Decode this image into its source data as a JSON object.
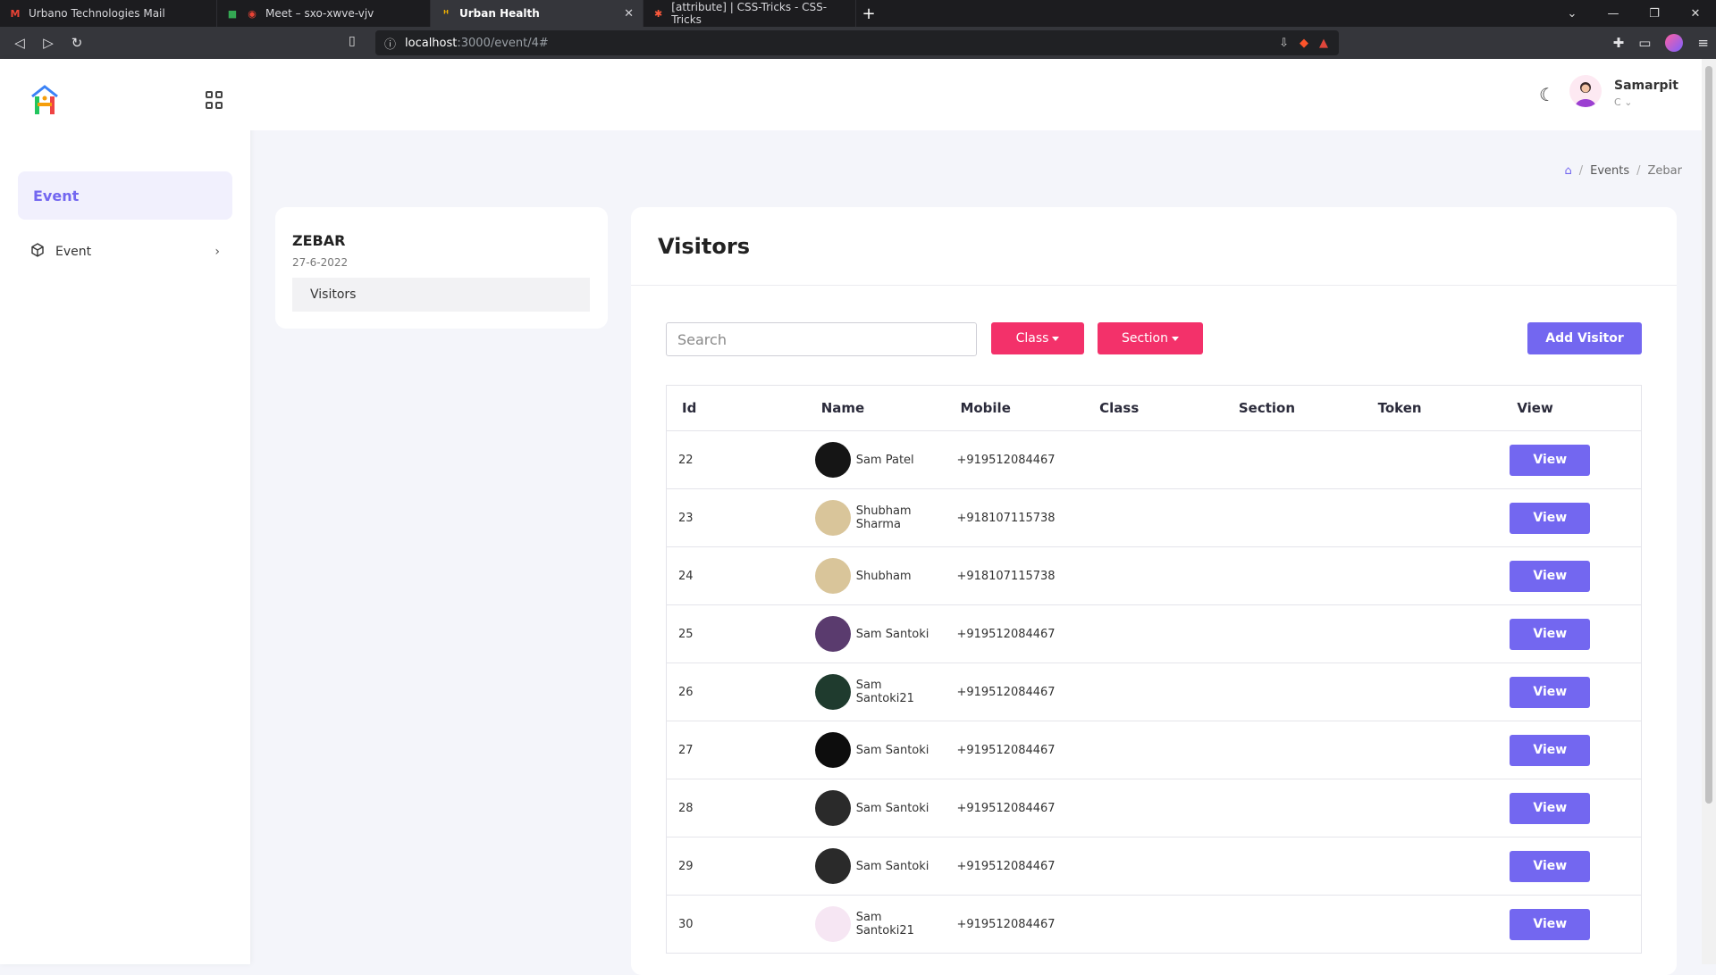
{
  "browser": {
    "tabs": [
      {
        "title": "Urbano Technologies Mail",
        "icon": "gmail-icon",
        "active": false
      },
      {
        "title": "Meet – sxo-xwve-vjv",
        "icon": "meet-icon",
        "active": false
      },
      {
        "title": "Urban Health",
        "icon": "urban-health-icon",
        "active": true
      },
      {
        "title": "[attribute] | CSS-Tricks - CSS-Tricks",
        "icon": "css-tricks-icon",
        "active": false
      }
    ],
    "url_host": "localhost",
    "url_path": ":3000/event/4#"
  },
  "sidebar": {
    "section_label": "Event",
    "items": [
      {
        "label": "Event",
        "icon": "cube-icon"
      }
    ]
  },
  "header": {
    "user_name": "Samarpit",
    "user_role": "C"
  },
  "breadcrumb": {
    "items": [
      "Events",
      "Zebar"
    ]
  },
  "event": {
    "name": "ZEBAR",
    "date": "27-6-2022",
    "nav_item": "Visitors"
  },
  "visitors": {
    "title": "Visitors",
    "search_placeholder": "Search",
    "class_button": "Class",
    "section_button": "Section",
    "add_button": "Add Visitor",
    "columns": [
      "Id",
      "Name",
      "Mobile",
      "Class",
      "Section",
      "Token",
      "View"
    ],
    "rows": [
      {
        "id": "22",
        "name": "Sam Patel",
        "mobile": "+919512084467",
        "class": "",
        "section": "",
        "token": "",
        "view": "View",
        "avatar_color": "#151515"
      },
      {
        "id": "23",
        "name": "Shubham Sharma",
        "mobile": "+918107115738",
        "class": "",
        "section": "",
        "token": "",
        "view": "View",
        "avatar_color": "#d9c59a"
      },
      {
        "id": "24",
        "name": "Shubham",
        "mobile": "+918107115738",
        "class": "",
        "section": "",
        "token": "",
        "view": "View",
        "avatar_color": "#d9c59a"
      },
      {
        "id": "25",
        "name": "Sam Santoki",
        "mobile": "+919512084467",
        "class": "",
        "section": "",
        "token": "",
        "view": "View",
        "avatar_color": "#5a3b6e"
      },
      {
        "id": "26",
        "name": "Sam Santoki21",
        "mobile": "+919512084467",
        "class": "",
        "section": "",
        "token": "",
        "view": "View",
        "avatar_color": "#1f3b2e"
      },
      {
        "id": "27",
        "name": "Sam Santoki",
        "mobile": "+919512084467",
        "class": "",
        "section": "",
        "token": "",
        "view": "View",
        "avatar_color": "#0d0d0d"
      },
      {
        "id": "28",
        "name": "Sam Santoki",
        "mobile": "+919512084467",
        "class": "",
        "section": "",
        "token": "",
        "view": "View",
        "avatar_color": "#2a2a2a"
      },
      {
        "id": "29",
        "name": "Sam Santoki",
        "mobile": "+919512084467",
        "class": "",
        "section": "",
        "token": "",
        "view": "View",
        "avatar_color": "#2a2a2a"
      },
      {
        "id": "30",
        "name": "Sam Santoki21",
        "mobile": "+919512084467",
        "class": "",
        "section": "",
        "token": "",
        "view": "View",
        "avatar_color": "#f6e6f3"
      }
    ]
  },
  "colors": {
    "accent": "#7367f0",
    "pink": "#f3316a"
  }
}
